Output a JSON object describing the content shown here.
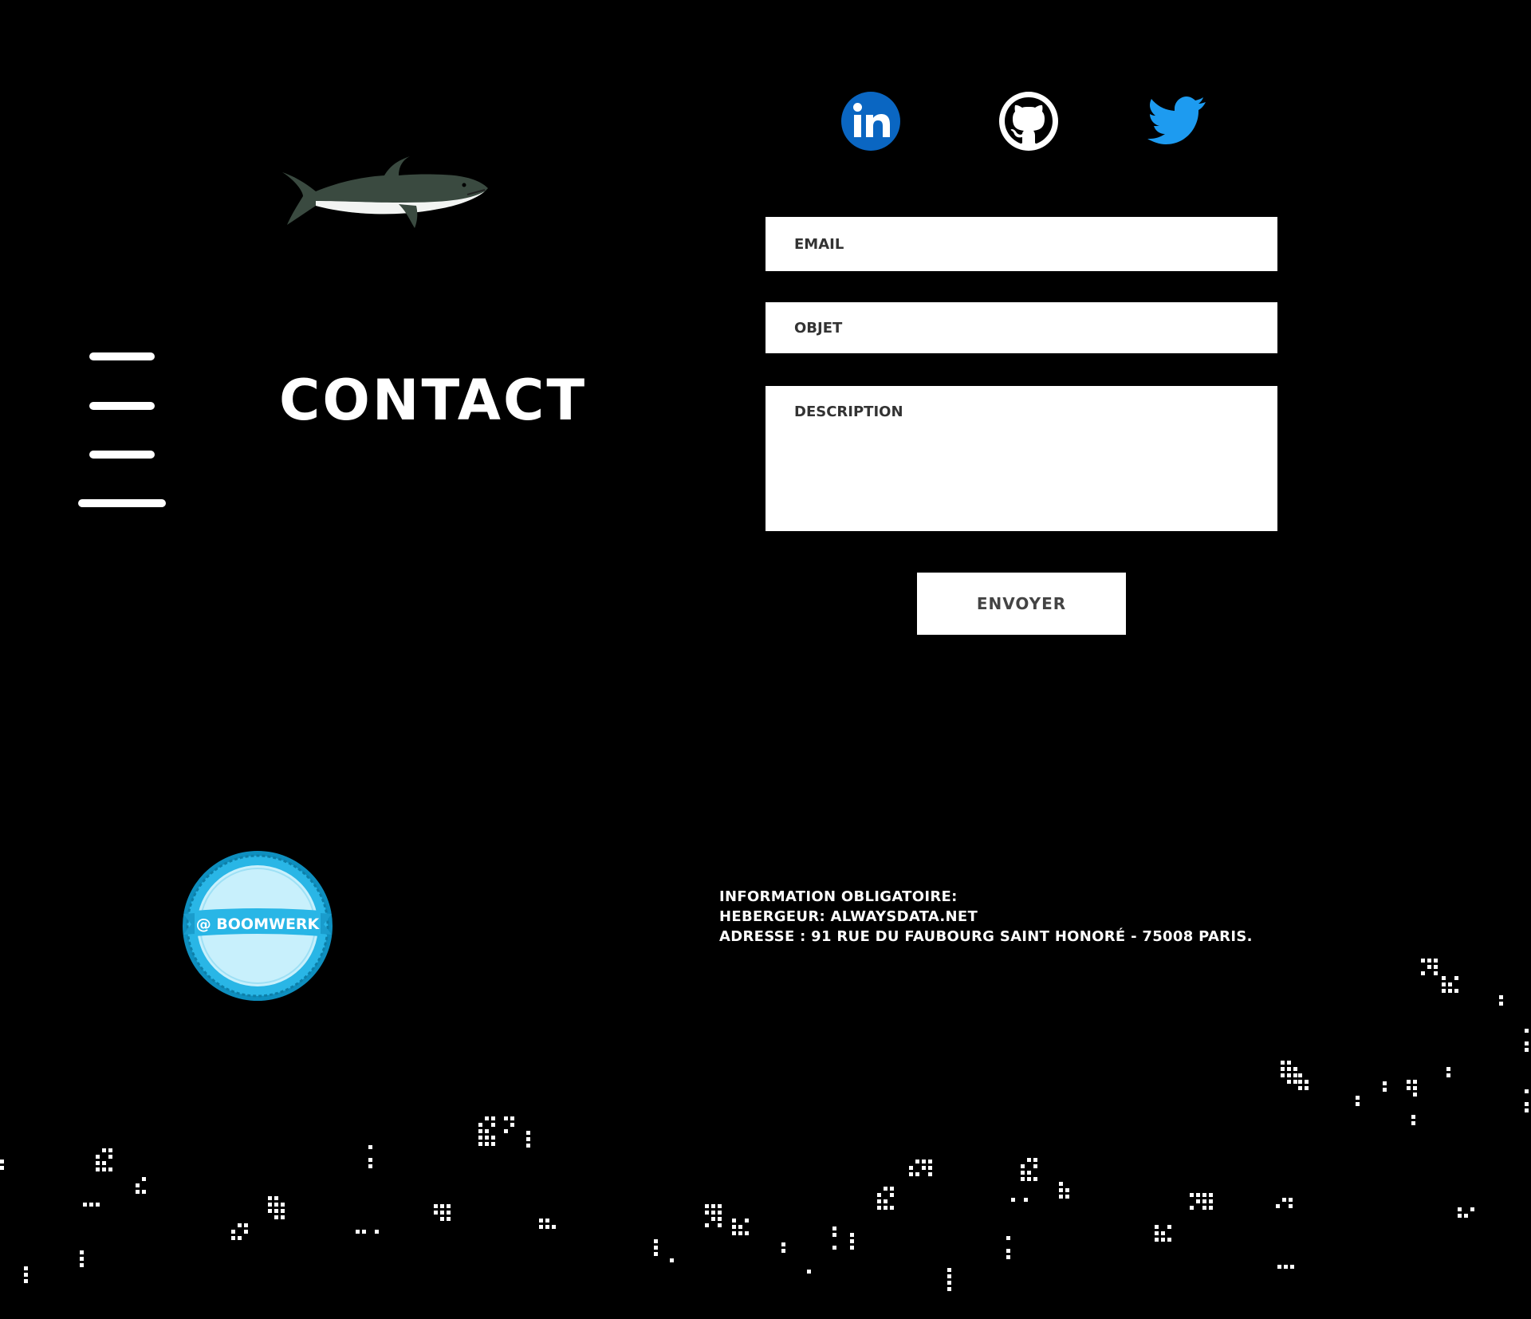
{
  "page": {
    "title": "Contact"
  },
  "social": {
    "linkedin": "linkedin-icon",
    "github": "github-icon",
    "twitter": "twitter-icon"
  },
  "form": {
    "email_placeholder": "Email",
    "objet_placeholder": "Objet",
    "description_placeholder": "Description",
    "email_value": "",
    "objet_value": "",
    "description_value": "",
    "send_label": "Envoyer"
  },
  "badge": {
    "text": "@ BOOMWERK"
  },
  "legal": {
    "line1": "Information obligatoire:",
    "line2": "Hebergeur: alwaysdata.net",
    "line3": "Adresse : 91 rue du Faubourg Saint Honoré - 75008 Paris."
  },
  "colors": {
    "background": "#000000",
    "linkedin": "#0a66c2",
    "twitter": "#1d9bf0",
    "badge": "#29b6e6"
  }
}
